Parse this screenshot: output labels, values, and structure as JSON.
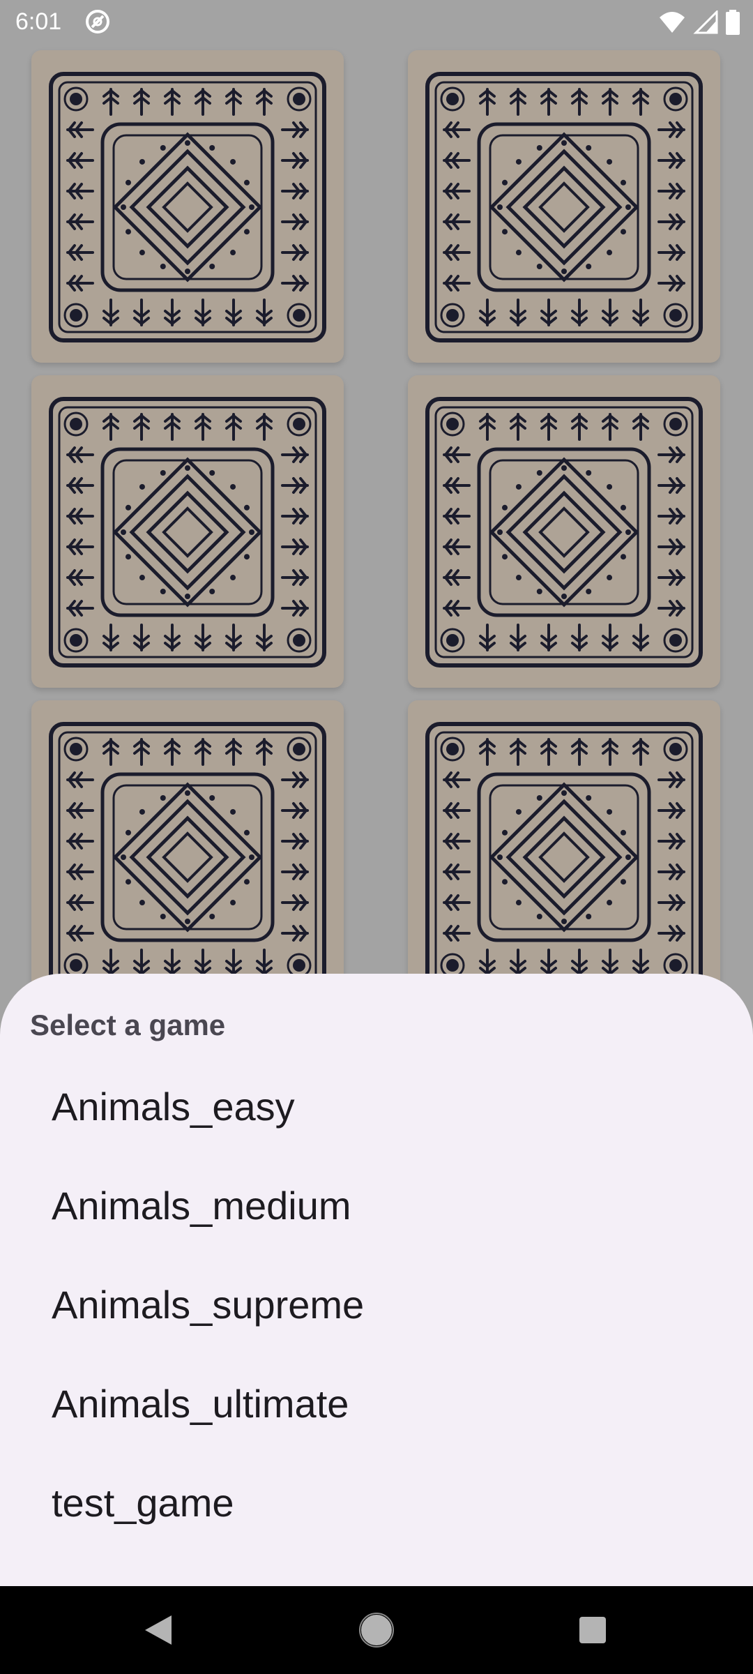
{
  "status_bar": {
    "time": "6:01",
    "app_icon": "at-sign-icon",
    "icons": [
      "wifi-icon",
      "signal-icon",
      "battery-icon"
    ]
  },
  "game_board": {
    "card_count_visible": 6,
    "card_back_pattern": "ornamental-square-pattern",
    "colors": {
      "card": "#aea396",
      "pattern_ink": "#1b1c2c",
      "backdrop": "#a3a3a3"
    }
  },
  "bottom_sheet": {
    "title": "Select a game",
    "options": [
      "Animals_easy",
      "Animals_medium",
      "Animals_supreme",
      "Animals_ultimate",
      "test_game"
    ],
    "background": "#f4eff7"
  },
  "nav_bar": {
    "buttons": [
      "back-icon",
      "home-icon",
      "recents-icon"
    ]
  }
}
